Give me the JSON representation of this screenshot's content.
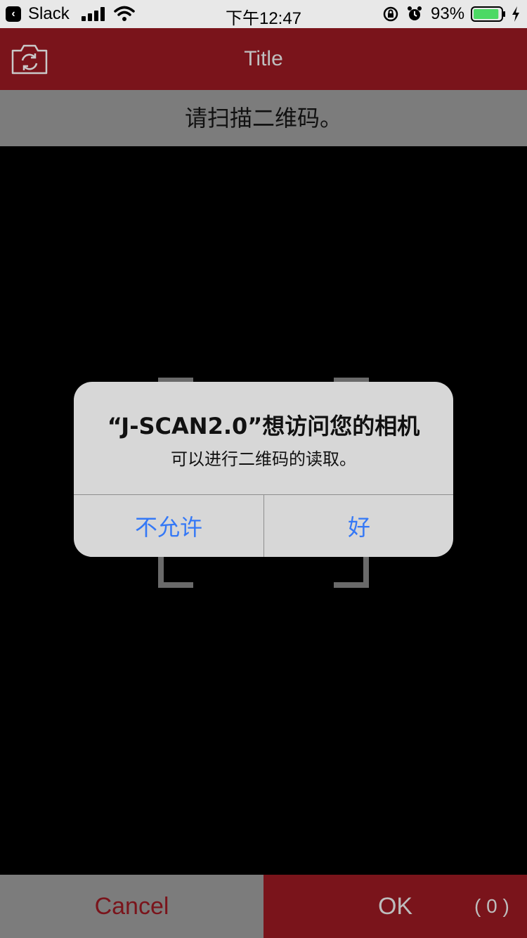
{
  "status_bar": {
    "back_app": "Slack",
    "time": "下午12:47",
    "battery_percent": "93%",
    "battery_level": 0.93,
    "icons": [
      "back-chevron-icon",
      "signal-icon",
      "wifi-icon",
      "rotation-lock-icon",
      "alarm-icon",
      "battery-icon",
      "charging-bolt-icon"
    ]
  },
  "nav_bar": {
    "title": "Title",
    "left_icon": "camera-switch-icon"
  },
  "instruction": "请扫描二维码。",
  "alert": {
    "title": "“J-SCAN2.0”想访问您的相机",
    "message": "可以进行二维码的读取。",
    "deny_label": "不允许",
    "allow_label": "好"
  },
  "bottom_bar": {
    "cancel_label": "Cancel",
    "ok_label": "OK",
    "count": "( 0 )"
  },
  "colors": {
    "brand_red": "#7a141b",
    "gray_bar": "#7c7c7c",
    "alert_blue": "#3478f6"
  }
}
